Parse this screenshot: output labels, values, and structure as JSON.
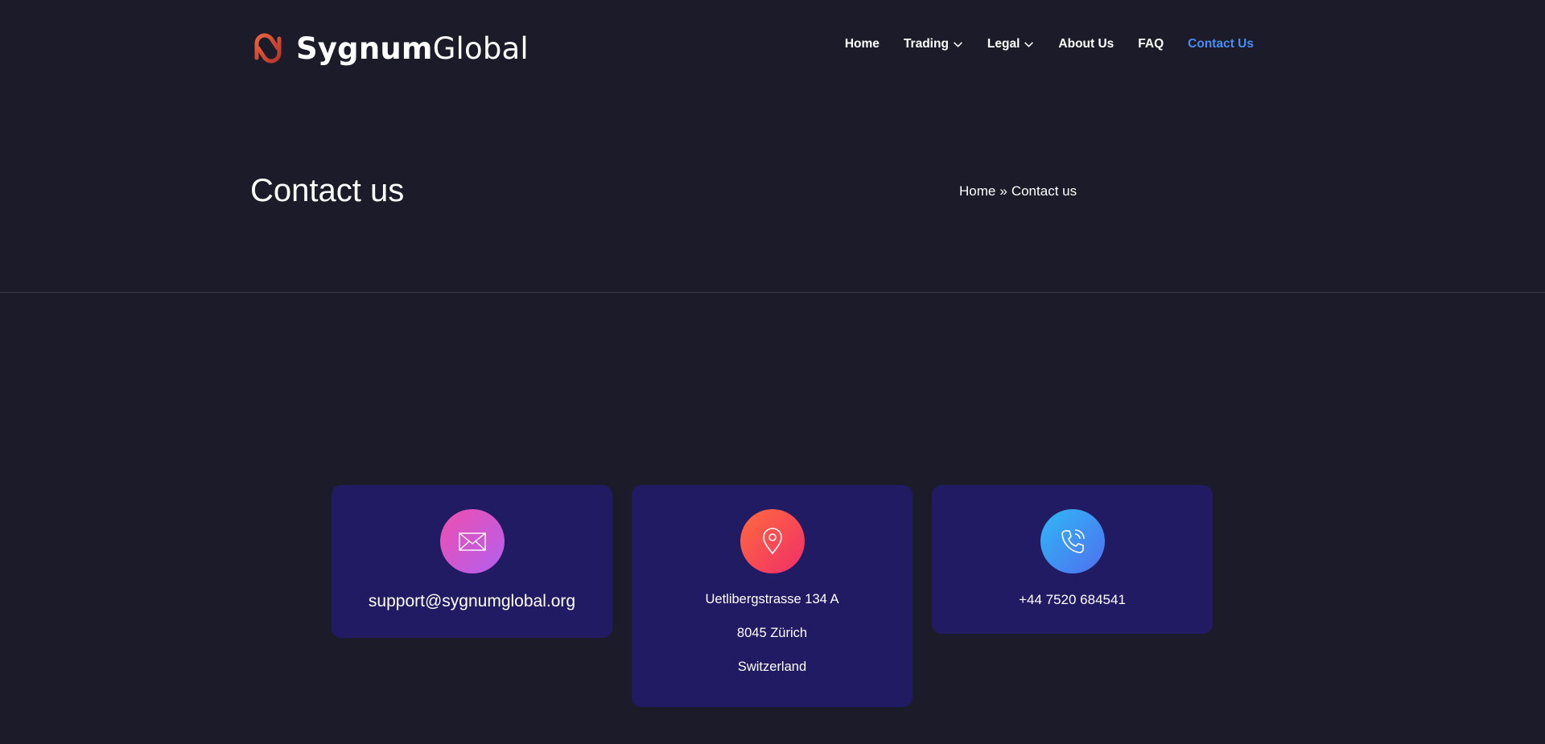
{
  "brand": {
    "name_bold": "Sygnum",
    "name_light": "Global"
  },
  "nav": {
    "items": [
      {
        "label": "Home"
      },
      {
        "label": "Trading"
      },
      {
        "label": "Legal"
      },
      {
        "label": "About Us"
      },
      {
        "label": "FAQ"
      },
      {
        "label": "Contact Us"
      }
    ]
  },
  "page": {
    "title": "Contact us",
    "breadcrumb": {
      "home": "Home",
      "separator": "»",
      "current": "Contact us"
    }
  },
  "contact": {
    "email": "support@sygnumglobal.org",
    "address": [
      "Uetlibergstrasse 134 A",
      "8045 Zürich",
      "Switzerland"
    ],
    "phone": "+44 7520 684541"
  },
  "colors": {
    "background": "#1c1b29",
    "card": "#211b63",
    "active_nav": "#4a8cf0",
    "logo": "#e0553a"
  }
}
